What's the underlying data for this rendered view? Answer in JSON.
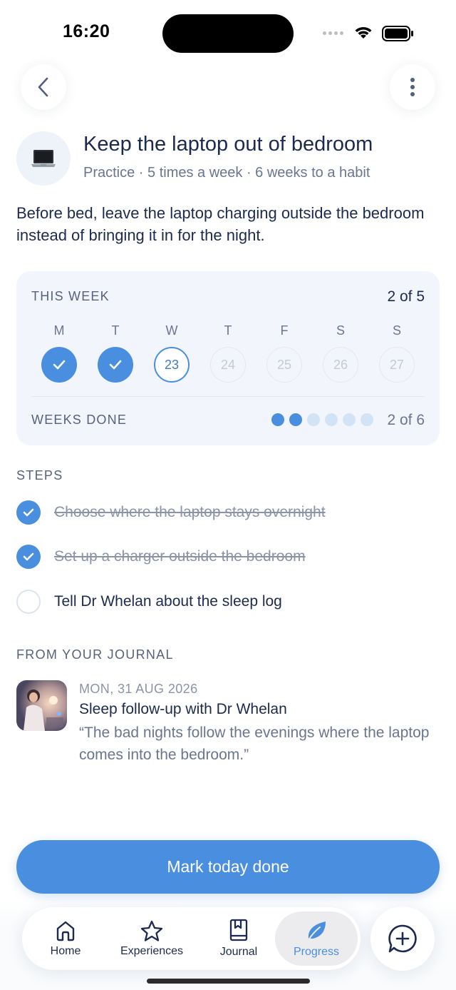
{
  "status_bar": {
    "time": "16:20"
  },
  "habit": {
    "title": "Keep the laptop out of bedroom",
    "meta": "Practice · 5 times a week · 6 weeks to a habit",
    "description": "Before bed, leave the laptop charging outside the bedroom instead of bringing it in for the night."
  },
  "week_card": {
    "label": "THIS WEEK",
    "count": "2 of 5",
    "days": [
      {
        "letter": "M",
        "state": "done",
        "number": ""
      },
      {
        "letter": "T",
        "state": "done",
        "number": ""
      },
      {
        "letter": "W",
        "state": "today",
        "number": "23"
      },
      {
        "letter": "T",
        "state": "future",
        "number": "24"
      },
      {
        "letter": "F",
        "state": "future",
        "number": "25"
      },
      {
        "letter": "S",
        "state": "future",
        "number": "26"
      },
      {
        "letter": "S",
        "state": "future",
        "number": "27"
      }
    ],
    "weeks_label": "WEEKS DONE",
    "weeks_done": 2,
    "weeks_total": 6,
    "weeks_count": "2 of 6"
  },
  "steps": {
    "label": "STEPS",
    "items": [
      {
        "text": "Choose where the laptop stays overnight",
        "done": true
      },
      {
        "text": "Set up a charger outside the bedroom",
        "done": true
      },
      {
        "text": "Tell Dr Whelan about the sleep log",
        "done": false
      }
    ]
  },
  "journal": {
    "label": "FROM YOUR JOURNAL",
    "date": "MON, 31 AUG 2026",
    "title": "Sleep follow-up with Dr Whelan",
    "quote": "“The bad nights follow the evenings where the laptop comes into the bedroom.”"
  },
  "cta": {
    "label": "Mark today done"
  },
  "tabs": [
    {
      "label": "Home",
      "icon": "home-icon",
      "active": false
    },
    {
      "label": "Experiences",
      "icon": "star-icon",
      "active": false
    },
    {
      "label": "Journal",
      "icon": "journal-icon",
      "active": false
    },
    {
      "label": "Progress",
      "icon": "leaf-icon",
      "active": true
    }
  ],
  "colors": {
    "accent": "#4a8ee0",
    "text": "#1d2a4f",
    "muted": "#6b7591",
    "card": "#f2f6fc"
  }
}
